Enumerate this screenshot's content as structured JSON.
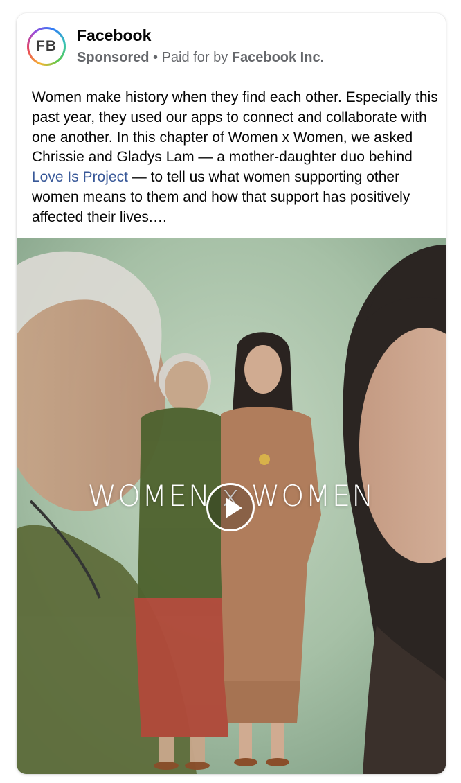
{
  "post": {
    "avatar_initials": "FB",
    "page_name": "Facebook",
    "sponsored_label": "Sponsored",
    "separator": "•",
    "paid_for_prefix": "Paid for by",
    "paid_for_by": "Facebook Inc.",
    "text_part1": "Women make history when they find each other. Especially this past year, they used our apps to connect and collaborate with one another. In this chapter of Women x Women, we asked Chrissie and Gladys Lam — a mother-daughter duo behind ",
    "text_link": "Love Is Project",
    "text_part2": " — to tell us what women supporting other women means to them and how that support has positively affected their lives.…"
  },
  "video": {
    "title_overlay": "WOMEN x WOMEN",
    "play_icon": "play-icon"
  },
  "colors": {
    "link": "#385898",
    "secondary_text": "#65676b",
    "background_green": "#a9c2a8"
  }
}
